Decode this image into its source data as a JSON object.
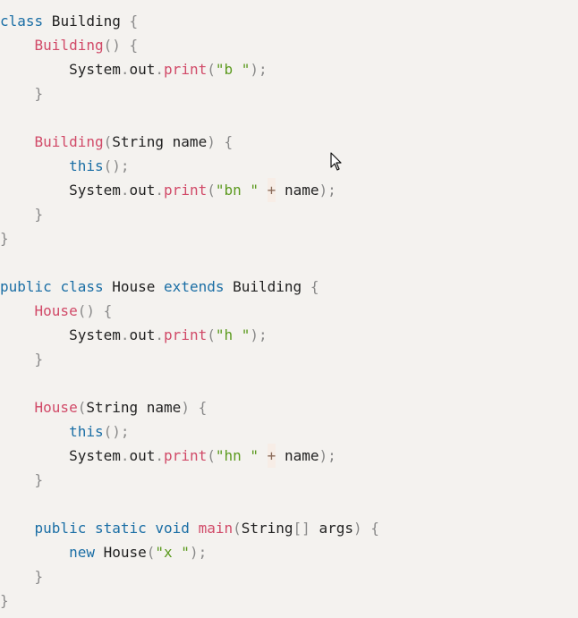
{
  "icons": {
    "mouse_cursor": "arrow-pointer-icon"
  },
  "colors": {
    "background": "#f4f2ef",
    "keyword": "#1a6ea5",
    "method": "#d14a68",
    "string": "#5b9a1e",
    "punctuation": "#8a8a8a",
    "identifier": "#222222"
  },
  "code": {
    "lines": [
      [
        [
          "kw",
          "class"
        ],
        [
          "ident",
          " Building "
        ],
        [
          "punct",
          "{"
        ]
      ],
      [
        [
          "ident",
          "    "
        ],
        [
          "fn",
          "Building"
        ],
        [
          "punct",
          "() {"
        ]
      ],
      [
        [
          "ident",
          "        System"
        ],
        [
          "punct",
          "."
        ],
        [
          "ident",
          "out"
        ],
        [
          "punct",
          "."
        ],
        [
          "fn",
          "print"
        ],
        [
          "punct",
          "("
        ],
        [
          "str",
          "\"b \""
        ],
        [
          "punct",
          ");"
        ]
      ],
      [
        [
          "ident",
          "    "
        ],
        [
          "punct",
          "}"
        ]
      ],
      [],
      [
        [
          "ident",
          "    "
        ],
        [
          "fn",
          "Building"
        ],
        [
          "punct",
          "("
        ],
        [
          "ident",
          "String name"
        ],
        [
          "punct",
          ") {"
        ]
      ],
      [
        [
          "ident",
          "        "
        ],
        [
          "kw",
          "this"
        ],
        [
          "punct",
          "();"
        ]
      ],
      [
        [
          "ident",
          "        System"
        ],
        [
          "punct",
          "."
        ],
        [
          "ident",
          "out"
        ],
        [
          "punct",
          "."
        ],
        [
          "fn",
          "print"
        ],
        [
          "punct",
          "("
        ],
        [
          "str",
          "\"bn \""
        ],
        [
          "ident",
          " "
        ],
        [
          "op",
          "+"
        ],
        [
          "ident",
          " name"
        ],
        [
          "punct",
          ");"
        ]
      ],
      [
        [
          "ident",
          "    "
        ],
        [
          "punct",
          "}"
        ]
      ],
      [
        [
          "punct",
          "}"
        ]
      ],
      [],
      [
        [
          "kw",
          "public"
        ],
        [
          "ident",
          " "
        ],
        [
          "kw",
          "class"
        ],
        [
          "ident",
          " House "
        ],
        [
          "kw",
          "extends"
        ],
        [
          "ident",
          " Building "
        ],
        [
          "punct",
          "{"
        ]
      ],
      [
        [
          "ident",
          "    "
        ],
        [
          "fn",
          "House"
        ],
        [
          "punct",
          "() {"
        ]
      ],
      [
        [
          "ident",
          "        System"
        ],
        [
          "punct",
          "."
        ],
        [
          "ident",
          "out"
        ],
        [
          "punct",
          "."
        ],
        [
          "fn",
          "print"
        ],
        [
          "punct",
          "("
        ],
        [
          "str",
          "\"h \""
        ],
        [
          "punct",
          ");"
        ]
      ],
      [
        [
          "ident",
          "    "
        ],
        [
          "punct",
          "}"
        ]
      ],
      [],
      [
        [
          "ident",
          "    "
        ],
        [
          "fn",
          "House"
        ],
        [
          "punct",
          "("
        ],
        [
          "ident",
          "String name"
        ],
        [
          "punct",
          ") {"
        ]
      ],
      [
        [
          "ident",
          "        "
        ],
        [
          "kw",
          "this"
        ],
        [
          "punct",
          "();"
        ]
      ],
      [
        [
          "ident",
          "        System"
        ],
        [
          "punct",
          "."
        ],
        [
          "ident",
          "out"
        ],
        [
          "punct",
          "."
        ],
        [
          "fn",
          "print"
        ],
        [
          "punct",
          "("
        ],
        [
          "str",
          "\"hn \""
        ],
        [
          "ident",
          " "
        ],
        [
          "op",
          "+"
        ],
        [
          "ident",
          " name"
        ],
        [
          "punct",
          ");"
        ]
      ],
      [
        [
          "ident",
          "    "
        ],
        [
          "punct",
          "}"
        ]
      ],
      [],
      [
        [
          "ident",
          "    "
        ],
        [
          "kw",
          "public"
        ],
        [
          "ident",
          " "
        ],
        [
          "kw",
          "static"
        ],
        [
          "ident",
          " "
        ],
        [
          "kw",
          "void"
        ],
        [
          "ident",
          " "
        ],
        [
          "fn",
          "main"
        ],
        [
          "punct",
          "("
        ],
        [
          "ident",
          "String"
        ],
        [
          "punct",
          "[]"
        ],
        [
          "ident",
          " args"
        ],
        [
          "punct",
          ") {"
        ]
      ],
      [
        [
          "ident",
          "        "
        ],
        [
          "kw",
          "new"
        ],
        [
          "ident",
          " House"
        ],
        [
          "punct",
          "("
        ],
        [
          "str",
          "\"x \""
        ],
        [
          "punct",
          ");"
        ]
      ],
      [
        [
          "ident",
          "    "
        ],
        [
          "punct",
          "}"
        ]
      ],
      [
        [
          "punct",
          "}"
        ]
      ]
    ]
  }
}
